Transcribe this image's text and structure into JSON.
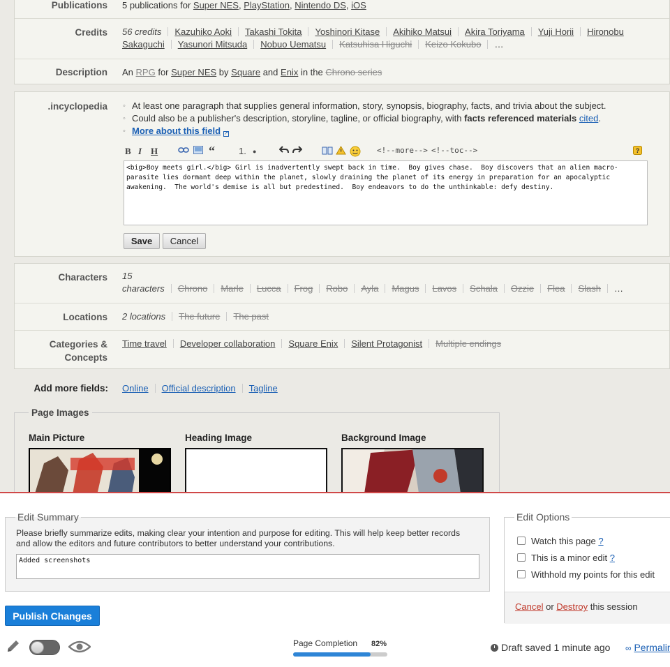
{
  "publications": {
    "label": "Publications",
    "prefix": "5 publications for",
    "platforms": [
      "Super NES",
      "PlayStation",
      "Nintendo DS",
      "iOS"
    ]
  },
  "credits": {
    "label": "Credits",
    "count": "56 credits",
    "people": [
      "Kazuhiko Aoki",
      "Takashi Tokita",
      "Yoshinori Kitase",
      "Akihiko Matsui",
      "Akira Toriyama",
      "Yuji Horii",
      "Hironobu Sakaguchi",
      "Yasunori Mitsuda",
      "Nobuo Uematsu"
    ],
    "struck": [
      "Katsuhisa Higuchi",
      "Keizo Kokubo"
    ],
    "more": "…"
  },
  "description": {
    "label": "Description",
    "an": "An",
    "genre": "RPG",
    "for": "for",
    "platform": "Super NES",
    "by": "by",
    "dev1": "Square",
    "and": "and",
    "dev2": "Enix",
    "inthe": "in the",
    "series": "Chrono series"
  },
  "incyclopedia": {
    "label": ".incyclopedia",
    "hint1": "At least one paragraph that supplies general information, story, synopsis, biography, facts, and trivia about the subject.",
    "hint2_pre": "Could also be a publisher's description, storyline, tagline, or official biography, with",
    "hint2_bold": "facts referenced materials",
    "hint2_link": "cited",
    "hint2_post": ".",
    "more_link": "More about this field",
    "toolbar": {
      "bold": "B",
      "italic": "I",
      "heading": "H",
      "ol": "1.",
      "ul": "●",
      "more": "<!--more-->",
      "toc": "<!--toc-->",
      "quote": "“"
    },
    "text": "<big>Boy meets girl.</big> Girl is inadvertently swept back in time.  Boy gives chase.  Boy discovers that an alien macro-parasite lies dormant deep within the planet, slowly draining the planet of its energy in preparation for an apocalyptic awakening.  The world's demise is all but predestined.  Boy endeavors to do the unthinkable: defy destiny.",
    "save": "Save",
    "cancel": "Cancel"
  },
  "characters": {
    "label": "Characters",
    "count1": "15",
    "count2": "characters",
    "names": [
      "Chrono",
      "Marle",
      "Lucca",
      "Frog",
      "Robo",
      "Ayla",
      "Magus",
      "Lavos",
      "Schala",
      "Ozzie",
      "Flea",
      "Slash"
    ],
    "more": "…"
  },
  "locations": {
    "label": "Locations",
    "count": "2 locations",
    "names": [
      "The future",
      "The past"
    ]
  },
  "categories": {
    "label1": "Categories &",
    "label2": "Concepts",
    "items": [
      "Time travel",
      "Developer collaboration",
      "Square Enix",
      "Silent Protagonist"
    ],
    "struck": "Multiple endings"
  },
  "add_more": {
    "label": "Add more fields:",
    "items": [
      "Online",
      "Official description",
      "Tagline"
    ]
  },
  "page_images": {
    "legend": "Page Images",
    "main": "Main Picture",
    "heading": "Heading Image",
    "background": "Background Image"
  },
  "edit_summary": {
    "legend": "Edit Summary",
    "help": "Please briefly summarize edits, making clear your intention and purpose for editing. This will help keep better records and allow the editors and future contributors to better understand your contributions.",
    "value": "Added screenshots"
  },
  "edit_options": {
    "legend": "Edit Options",
    "watch": "Watch this page",
    "minor": "This is a minor edit",
    "withhold": "Withhold my points for this edit",
    "help": "?",
    "cancel": "Cancel",
    "or": "or",
    "destroy": "Destroy",
    "session": "this session"
  },
  "publish": "Publish Changes",
  "completion": {
    "label": "Page Completion",
    "percent": "82%",
    "fraction": 0.82
  },
  "draft": "Draft saved 1 minute ago",
  "permalink": "Permalink",
  "colors": {
    "accent": "#1a7fd9",
    "danger": "#c0392b",
    "divider": "#d04848"
  }
}
